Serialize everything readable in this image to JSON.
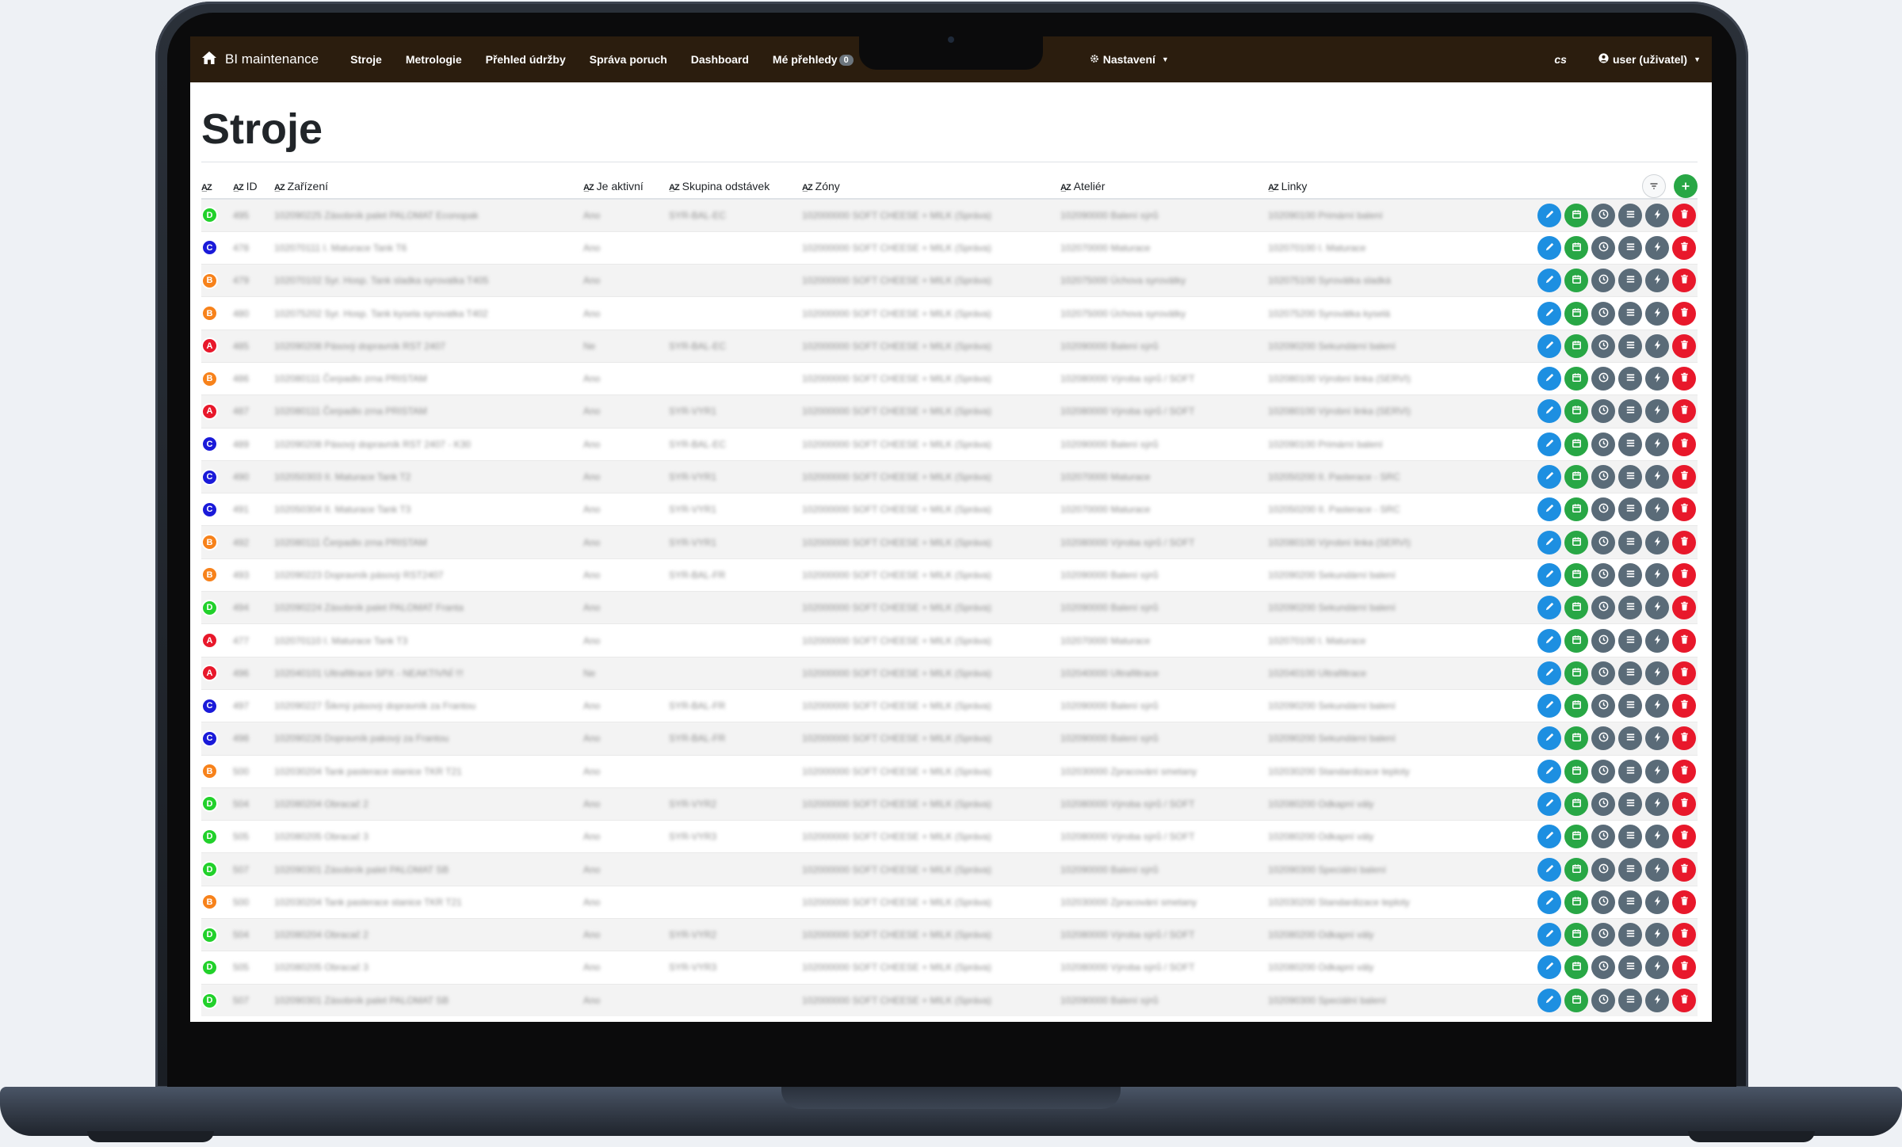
{
  "colors": {
    "navbar": "#2b1d0e",
    "critA": "#e8182b",
    "critB": "#f7821b",
    "critC": "#1a1ad9",
    "critD": "#22d12b",
    "edit": "#1d8fe1",
    "calendar": "#28a745",
    "secondary": "#5a6b78",
    "delete": "#e8182b"
  },
  "navbar": {
    "brand": "BI maintenance",
    "items": [
      "Stroje",
      "Metrologie",
      "Přehled údržby",
      "Správa poruch",
      "Dashboard",
      "Mé přehledy"
    ],
    "badge": "0",
    "settings": "Nastavení",
    "lang": "cs",
    "user": "user (uživatel)"
  },
  "page": {
    "title": "Stroje"
  },
  "table": {
    "headers": [
      "",
      "ID",
      "Zařízení",
      "Je aktivní",
      "Skupina odstávek",
      "Zóny",
      "Ateliér",
      "Linky"
    ],
    "rows": [
      {
        "c": "D",
        "id": "495",
        "name": "102090225 Zásobník palet PALOMAT Econopak",
        "active": "Ano",
        "group": "SYR-BAL-EC",
        "zone": "102000000 SOFT CHEESE + MILK (Správa)",
        "atelier": "102090000 Balení sýrů",
        "line": "102090100 Primární balení"
      },
      {
        "c": "C",
        "id": "478",
        "name": "102070111 I. Maturace Tank T6",
        "active": "Ano",
        "group": "",
        "zone": "102000000 SOFT CHEESE + MILK (Správa)",
        "atelier": "102070000 Maturace",
        "line": "102070100 I. Maturace"
      },
      {
        "c": "B",
        "id": "479",
        "name": "102070102 Syr. Hosp. Tank sladka syrovatka T405",
        "active": "Ano",
        "group": "",
        "zone": "102000000 SOFT CHEESE + MILK (Správa)",
        "atelier": "102075000 Úchova syrovátky",
        "line": "102075100 Syrovátka sladká"
      },
      {
        "c": "B",
        "id": "480",
        "name": "102075202 Syr. Hosp. Tank kysela syrovatka T402",
        "active": "Ano",
        "group": "",
        "zone": "102000000 SOFT CHEESE + MILK (Správa)",
        "atelier": "102075000 Úchova syrovátky",
        "line": "102075200 Syrovátka kyselá"
      },
      {
        "c": "A",
        "id": "485",
        "name": "102090208 Pásový dopravník RST 2407",
        "active": "Ne",
        "group": "SYR-BAL-EC",
        "zone": "102000000 SOFT CHEESE + MILK (Správa)",
        "atelier": "102090000 Balení sýrů",
        "line": "102090200 Sekundární balení"
      },
      {
        "c": "B",
        "id": "486",
        "name": "102080111 Čerpadlo zrna PRISTAM",
        "active": "Ano",
        "group": "",
        "zone": "102000000 SOFT CHEESE + MILK (Správa)",
        "atelier": "102080000 Výroba sýrů / SOFT",
        "line": "102080100 Výrobní linka (SERVI)"
      },
      {
        "c": "A",
        "id": "487",
        "name": "102080111 Čerpadlo zrna PRISTAM",
        "active": "Ano",
        "group": "SYR-VYR1",
        "zone": "102000000 SOFT CHEESE + MILK (Správa)",
        "atelier": "102080000 Výroba sýrů / SOFT",
        "line": "102080100 Výrobní linka (SERVI)"
      },
      {
        "c": "C",
        "id": "489",
        "name": "102090208 Pásový dopravník RST 2407 - K30",
        "active": "Ano",
        "group": "SYR-BAL-EC",
        "zone": "102000000 SOFT CHEESE + MILK (Správa)",
        "atelier": "102090000 Balení sýrů",
        "line": "102090100 Primární balení"
      },
      {
        "c": "C",
        "id": "490",
        "name": "102050303 II. Maturace Tank T2",
        "active": "Ano",
        "group": "SYR-VYR1",
        "zone": "102000000 SOFT CHEESE + MILK (Správa)",
        "atelier": "102070000 Maturace",
        "line": "102050200 II. Pasterace - SRC"
      },
      {
        "c": "C",
        "id": "491",
        "name": "102050304 II. Maturace Tank T3",
        "active": "Ano",
        "group": "SYR-VYR1",
        "zone": "102000000 SOFT CHEESE + MILK (Správa)",
        "atelier": "102070000 Maturace",
        "line": "102050200 II. Pasterace - SRC"
      },
      {
        "c": "B",
        "id": "492",
        "name": "102080111 Čerpadlo zrna PRISTAM",
        "active": "Ano",
        "group": "SYR-VYR1",
        "zone": "102000000 SOFT CHEESE + MILK (Správa)",
        "atelier": "102080000 Výroba sýrů / SOFT",
        "line": "102080100 Výrobní linka (SERVI)"
      },
      {
        "c": "B",
        "id": "493",
        "name": "102090223 Dopravník pásový RST2407",
        "active": "Ano",
        "group": "SYR-BAL-FR",
        "zone": "102000000 SOFT CHEESE + MILK (Správa)",
        "atelier": "102090000 Balení sýrů",
        "line": "102090200 Sekundární balení"
      },
      {
        "c": "D",
        "id": "494",
        "name": "102090224 Zásobník palet PALOMAT Franta",
        "active": "Ano",
        "group": "",
        "zone": "102000000 SOFT CHEESE + MILK (Správa)",
        "atelier": "102090000 Balení sýrů",
        "line": "102090200 Sekundární balení"
      },
      {
        "c": "A",
        "id": "477",
        "name": "102070110 I. Maturace Tank T3",
        "active": "Ano",
        "group": "",
        "zone": "102000000 SOFT CHEESE + MILK (Správa)",
        "atelier": "102070000 Maturace",
        "line": "102070100 I. Maturace"
      },
      {
        "c": "A",
        "id": "496",
        "name": "102040101 Ultrafiltrace SPX - NEAKTIVNÍ !!!",
        "active": "Ne",
        "group": "",
        "zone": "102000000 SOFT CHEESE + MILK (Správa)",
        "atelier": "102040000 Ultrafiltrace",
        "line": "102040100 Ultrafiltrace"
      },
      {
        "c": "C",
        "id": "497",
        "name": "102090227 Šikmý pásový dopravník za Frantou",
        "active": "Ano",
        "group": "SYR-BAL-FR",
        "zone": "102000000 SOFT CHEESE + MILK (Správa)",
        "atelier": "102090000 Balení sýrů",
        "line": "102090200 Sekundární balení"
      },
      {
        "c": "C",
        "id": "498",
        "name": "102090226 Dopravník pakový za Frantou",
        "active": "Ano",
        "group": "SYR-BAL-FR",
        "zone": "102000000 SOFT CHEESE + MILK (Správa)",
        "atelier": "102090000 Balení sýrů",
        "line": "102090200 Sekundární balení"
      },
      {
        "c": "B",
        "id": "500",
        "name": "102030204 Tank pasterace stanice TKR T21",
        "active": "Ano",
        "group": "",
        "zone": "102000000 SOFT CHEESE + MILK (Správa)",
        "atelier": "102030000 Zpracování smetany",
        "line": "102030200 Standardizace teploty"
      },
      {
        "c": "D",
        "id": "504",
        "name": "102080204 Obracač 2",
        "active": "Ano",
        "group": "SYR-VYR2",
        "zone": "102000000 SOFT CHEESE + MILK (Správa)",
        "atelier": "102080000 Výroba sýrů / SOFT",
        "line": "102080200 Odkapní vály"
      },
      {
        "c": "D",
        "id": "505",
        "name": "102080205 Obracač 3",
        "active": "Ano",
        "group": "SYR-VYR3",
        "zone": "102000000 SOFT CHEESE + MILK (Správa)",
        "atelier": "102080000 Výroba sýrů / SOFT",
        "line": "102080200 Odkapní vály"
      },
      {
        "c": "D",
        "id": "507",
        "name": "102090301 Zásobník palet PALOMAT SB",
        "active": "Ano",
        "group": "",
        "zone": "102000000 SOFT CHEESE + MILK (Správa)",
        "atelier": "102090000 Balení sýrů",
        "line": "102090300 Speciální balení"
      },
      {
        "c": "B",
        "id": "500",
        "name": "102030204 Tank pasterace stanice TKR T21",
        "active": "Ano",
        "group": "",
        "zone": "102000000 SOFT CHEESE + MILK (Správa)",
        "atelier": "102030000 Zpracování smetany",
        "line": "102030200 Standardizace teploty"
      },
      {
        "c": "D",
        "id": "504",
        "name": "102080204 Obracač 2",
        "active": "Ano",
        "group": "SYR-VYR2",
        "zone": "102000000 SOFT CHEESE + MILK (Správa)",
        "atelier": "102080000 Výroba sýrů / SOFT",
        "line": "102080200 Odkapní vály"
      },
      {
        "c": "D",
        "id": "505",
        "name": "102080205 Obracač 3",
        "active": "Ano",
        "group": "SYR-VYR3",
        "zone": "102000000 SOFT CHEESE + MILK (Správa)",
        "atelier": "102080000 Výroba sýrů / SOFT",
        "line": "102080200 Odkapní vály"
      },
      {
        "c": "D",
        "id": "507",
        "name": "102090301 Zásobník palet PALOMAT SB",
        "active": "Ano",
        "group": "",
        "zone": "102000000 SOFT CHEESE + MILK (Správa)",
        "atelier": "102090000 Balení sýrů",
        "line": "102090300 Speciální balení"
      }
    ]
  }
}
